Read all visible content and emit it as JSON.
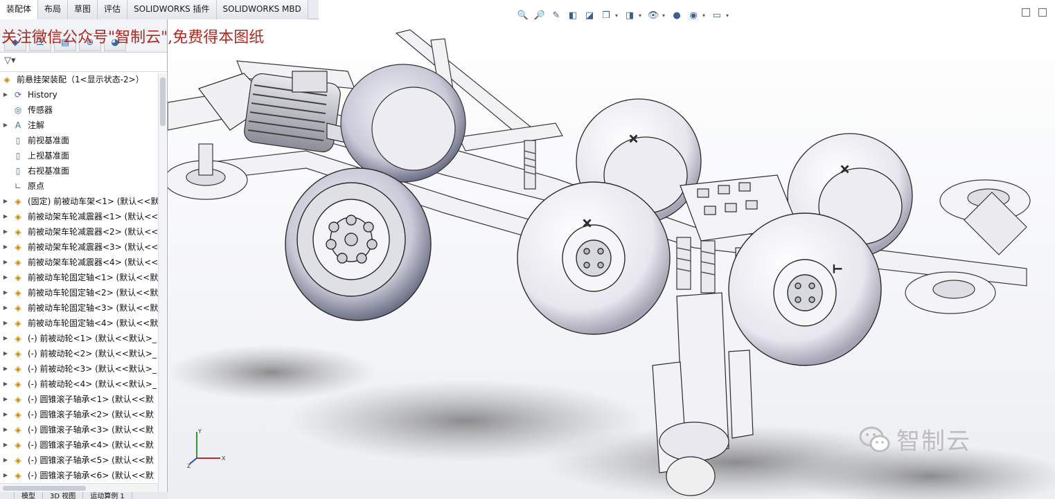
{
  "command_tabs": [
    "装配体",
    "布局",
    "草图",
    "评估",
    "SOLIDWORKS 插件",
    "SOLIDWORKS MBD"
  ],
  "watermark_top": "关注微信公众号\"智制云\",免费得本图纸",
  "watermark_bottom": "智制云",
  "tree_root": "前悬挂架装配（1<显示状态-2>）",
  "tree": [
    {
      "label": "History",
      "icon": "history-icon",
      "arrow": true
    },
    {
      "label": "传感器",
      "icon": "sensor-icon",
      "arrow": false
    },
    {
      "label": "注解",
      "icon": "annotation-icon",
      "arrow": true
    },
    {
      "label": "前视基准面",
      "icon": "plane-icon",
      "arrow": false
    },
    {
      "label": "上视基准面",
      "icon": "plane-icon",
      "arrow": false
    },
    {
      "label": "右视基准面",
      "icon": "plane-icon",
      "arrow": false
    },
    {
      "label": "原点",
      "icon": "origin-icon",
      "arrow": false
    },
    {
      "label": "(固定) 前被动车架<1> (默认<<默",
      "icon": "part-icon",
      "arrow": true
    },
    {
      "label": "前被动架车轮减震器<1> (默认<<",
      "icon": "part-icon",
      "arrow": true
    },
    {
      "label": "前被动架车轮减震器<2> (默认<<",
      "icon": "part-icon",
      "arrow": true
    },
    {
      "label": "前被动架车轮减震器<3> (默认<<",
      "icon": "part-icon",
      "arrow": true
    },
    {
      "label": "前被动架车轮减震器<4> (默认<<",
      "icon": "part-icon",
      "arrow": true
    },
    {
      "label": "前被动车轮固定轴<1> (默认<<默",
      "icon": "part-icon",
      "arrow": true
    },
    {
      "label": "前被动车轮固定轴<2> (默认<<默",
      "icon": "part-icon",
      "arrow": true
    },
    {
      "label": "前被动车轮固定轴<3> (默认<<默",
      "icon": "part-icon",
      "arrow": true
    },
    {
      "label": "前被动车轮固定轴<4> (默认<<默",
      "icon": "part-icon",
      "arrow": true
    },
    {
      "label": "(-) 前被动轮<1> (默认<<默认>_",
      "icon": "part-icon",
      "arrow": true
    },
    {
      "label": "(-) 前被动轮<2> (默认<<默认>_",
      "icon": "part-icon",
      "arrow": true
    },
    {
      "label": "(-) 前被动轮<3> (默认<<默认>_",
      "icon": "part-icon",
      "arrow": true
    },
    {
      "label": "(-) 前被动轮<4> (默认<<默认>_",
      "icon": "part-icon",
      "arrow": true
    },
    {
      "label": "(-) 圆锥滚子轴承<1> (默认<<默",
      "icon": "part-icon",
      "arrow": true
    },
    {
      "label": "(-) 圆锥滚子轴承<2> (默认<<默",
      "icon": "part-icon",
      "arrow": true
    },
    {
      "label": "(-) 圆锥滚子轴承<3> (默认<<默",
      "icon": "part-icon",
      "arrow": true
    },
    {
      "label": "(-) 圆锥滚子轴承<4> (默认<<默",
      "icon": "part-icon",
      "arrow": true
    },
    {
      "label": "(-) 圆锥滚子轴承<5> (默认<<默",
      "icon": "part-icon",
      "arrow": true
    },
    {
      "label": "(-) 圆锥滚子轴承<6> (默认<<默",
      "icon": "part-icon",
      "arrow": true
    }
  ],
  "bottom_tabs": [
    "",
    "模型",
    "3D 视图",
    "运动算例 1"
  ],
  "triad": {
    "x": "X",
    "y": "Y",
    "z": "Z"
  },
  "colors": {
    "watermark_red": "#b3261e",
    "watermark_gray": "#bdbdbd",
    "accent_blue": "#3b5f8f"
  }
}
